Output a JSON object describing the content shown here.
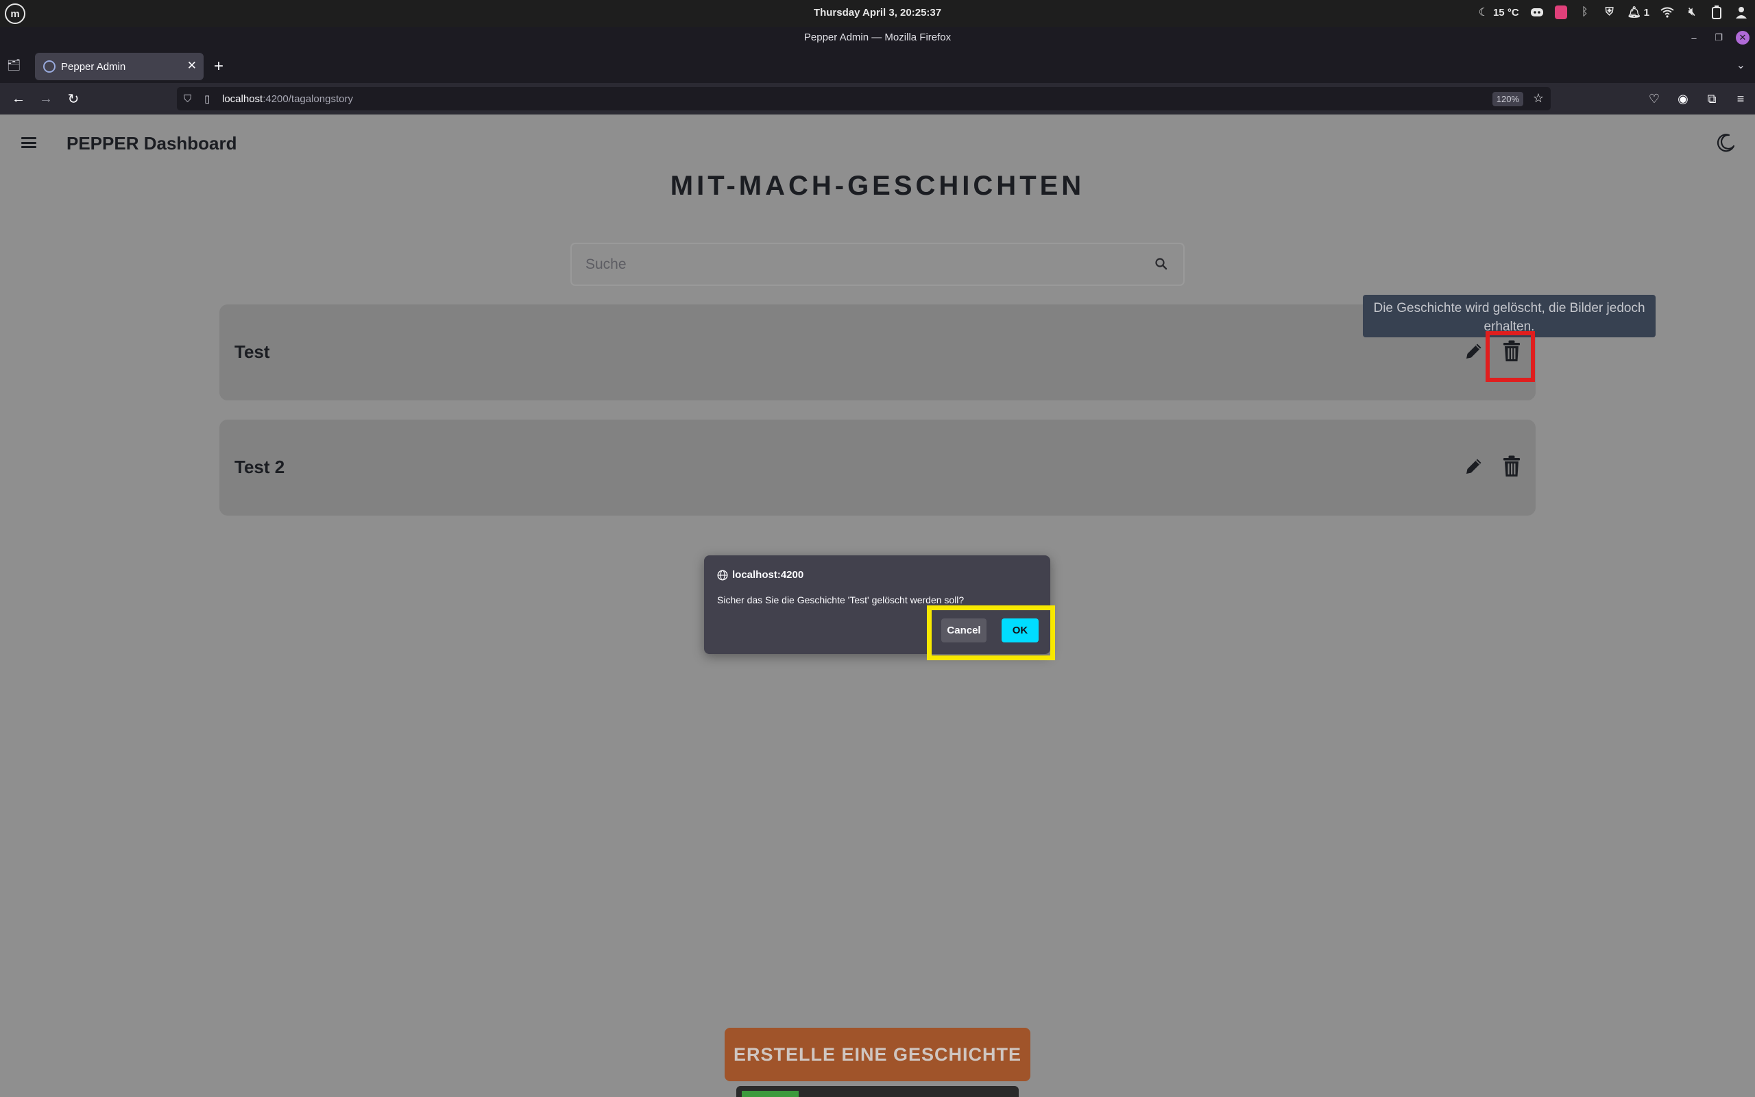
{
  "os": {
    "clock": "Thursday April 3, 20:25:37",
    "weather": "15 °C",
    "notifications_count": "1",
    "tray_icons": [
      "moon-icon",
      "discord-icon",
      "app-icon",
      "bluetooth-icon",
      "shield-icon",
      "notification-icon",
      "wifi-icon",
      "volume-muted-icon",
      "battery-icon",
      "user-icon"
    ]
  },
  "browser": {
    "window_title": "Pepper Admin — Mozilla Firefox",
    "tab_title": "Pepper Admin",
    "url_host": "localhost",
    "url_path": ":4200/tagalongstory",
    "zoom": "120%"
  },
  "app": {
    "title": "PEPPER Dashboard",
    "heading": "MIT-MACH-GESCHICHTEN",
    "search_placeholder": "Suche",
    "stories": [
      {
        "title": "Test"
      },
      {
        "title": "Test 2"
      }
    ],
    "delete_tooltip": "Die Geschichte wird gelöscht, die Bilder jedoch erhalten.",
    "create_button": "ERSTELLE EINE GESCHICHTE",
    "progress_fraction": 0.21
  },
  "dialog": {
    "origin": "localhost:4200",
    "message": "Sicher das Sie die Geschichte 'Test' gelöscht werden soll?",
    "cancel_label": "Cancel",
    "ok_label": "OK"
  },
  "colors": {
    "accent_ok": "#00ddff",
    "create_button": "#a0542a",
    "highlight_red": "#e01e1e",
    "highlight_yellow": "#f7e800"
  }
}
